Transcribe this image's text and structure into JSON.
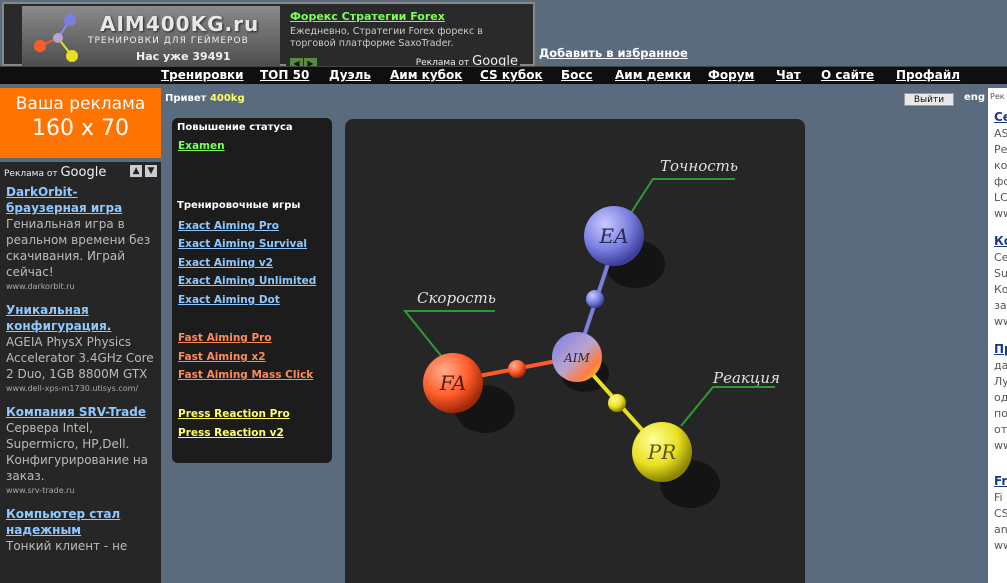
{
  "header": {
    "logo_title": "AIM400KG.ru",
    "logo_subtitle": "ТРЕНИРОВКИ ДЛЯ ГЕЙМЕРОВ",
    "logo_count": "Нас уже 39491",
    "top_ad": {
      "title": "Форекс Стратегии Forex",
      "text": "Ежедневно, Стратегии Forex форекс в торговой платформе SaxoTrader.",
      "ads_by_prefix": "Реклама от",
      "ads_by_brand": "Google"
    },
    "favorites_link": "Добавить в избранное"
  },
  "nav": {
    "items": [
      "Тренировки",
      "ТОП 50",
      "Дуэль",
      "Аим кубок",
      "CS кубок",
      "Босс",
      "Аим демки",
      "Форум",
      "Чат",
      "О сайте",
      "Профайл"
    ]
  },
  "left": {
    "ad_block": {
      "line1": "Ваша реклама",
      "line2": "160 x 70"
    },
    "ads_by_prefix": "Реклама от",
    "ads_by_brand": "Google",
    "ads": [
      {
        "title": "DarkOrbit-браузерная игра",
        "text": "Гениальная игра в реальном времени без скачивания. Играй сейчас!",
        "url": "www.darkorbit.ru"
      },
      {
        "title": "Уникальная конфигурация.",
        "text": "AGEIA PhysX Physics Accelerator 3.4GHz Core 2 Duo, 1GB 8800M GTX",
        "url": "www.dell-xps-m1730.utisys.com/"
      },
      {
        "title": "Компания SRV-Trade",
        "text": "Сервера Intel, Supermicro, HP,Dell. Конфигурирование на заказ.",
        "url": "www.srv-trade.ru"
      },
      {
        "title": "Компьютер стал надежным",
        "text": "Тонкий клиент - не",
        "url": ""
      }
    ]
  },
  "greeting": {
    "prefix": "Привет",
    "user": "400kg"
  },
  "logout_label": "Выйти",
  "lang_label": "eng",
  "menu": {
    "status_heading": "Повышение статуса",
    "status_link": "Examen",
    "games_heading": "Тренировочные игры",
    "exact": [
      "Exact Aiming Pro",
      "Exact Aiming Survival",
      "Exact Aiming v2",
      "Exact Aiming Unlimited",
      "Exact Aiming Dot"
    ],
    "fast": [
      "Fast Aiming Pro",
      "Fast Aiming x2",
      "Fast Aiming Mass Click"
    ],
    "press": [
      "Press Reaction Pro",
      "Press Reaction v2"
    ]
  },
  "stage": {
    "label_accuracy": "Точность",
    "label_speed": "Скорость",
    "label_reaction": "Реакция",
    "node_ea": "EA",
    "node_fa": "FA",
    "node_aim": "AIM",
    "node_pr": "PR",
    "colors": {
      "ea": "#7b7fe0",
      "fa": "#ff5a2a",
      "pr": "#e8e020"
    }
  },
  "right": {
    "head": "Рек",
    "items": [
      {
        "title": "Се",
        "lines": [
          "AS",
          "Ре",
          "ко",
          "фо",
          "LC",
          "ww"
        ]
      },
      {
        "title": "Ко",
        "lines": [
          "Се",
          "Su",
          "Ко",
          "за",
          "ww"
        ]
      },
      {
        "title": "Пр",
        "lines": [
          "да",
          "Лу",
          "од",
          "по",
          "от",
          "ww"
        ]
      },
      {
        "title": "Fr",
        "lines": [
          "Fi",
          "CS",
          "an",
          "ww"
        ]
      }
    ]
  }
}
